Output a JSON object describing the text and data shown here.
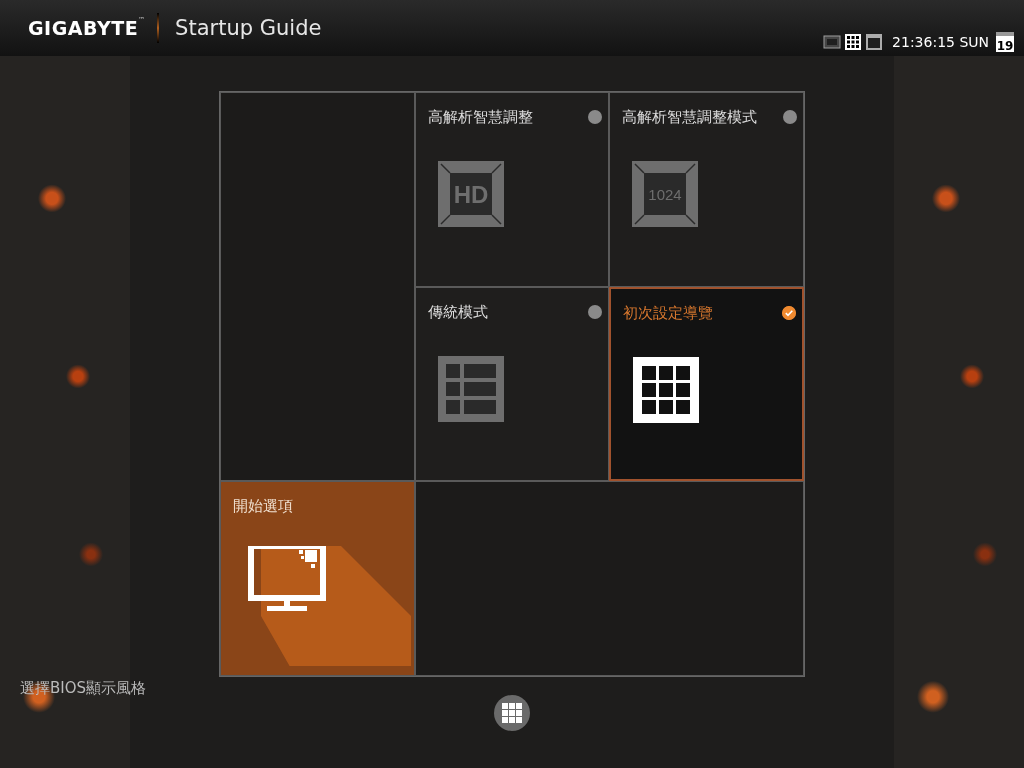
{
  "header": {
    "brand": "GIGABYTE",
    "brand_mark": "™",
    "title": "Startup Guide",
    "mode_icons": [
      {
        "kind": "hd",
        "selected": false
      },
      {
        "kind": "grid",
        "selected": true
      },
      {
        "kind": "window",
        "selected": false
      }
    ],
    "clock": "21:36:15 SUN",
    "date": "19"
  },
  "mode_tiles": [
    {
      "title": "高解析智慧調整",
      "kind": "hd",
      "icon_label": "HD",
      "selected": false
    },
    {
      "title": "高解析智慧調整模式",
      "kind": "number",
      "icon_label": "1024",
      "selected": false
    },
    {
      "title": "傳統模式",
      "kind": "table",
      "selected": false
    },
    {
      "title": "初次設定導覽",
      "kind": "grid",
      "selected": true
    }
  ],
  "start_tile": {
    "title": "開始選項"
  },
  "hint": "選擇BIOS顯示風格"
}
